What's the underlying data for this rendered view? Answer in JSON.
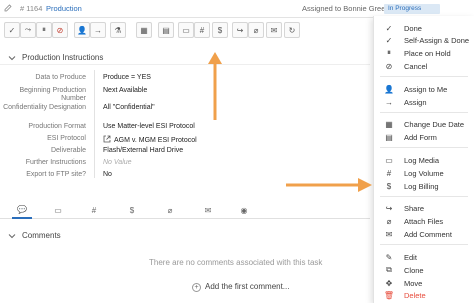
{
  "header": {
    "task_number": "# 1164",
    "task_title": "Production",
    "assigned_text": "Assigned to Bonnie Green by CS",
    "status_badge": "In Progress"
  },
  "toolbar": {
    "buttons": [
      "check-icon",
      "reassign-icon",
      "pause-icon",
      "cancel-icon",
      "assign-icon",
      "advance-icon",
      "flask-icon",
      "due-date-icon",
      "form-icon",
      "media-icon",
      "volume-icon",
      "billing-icon",
      "share-icon",
      "attach-icon",
      "comment-icon",
      "repeat-icon"
    ]
  },
  "section": {
    "title": "Production Instructions"
  },
  "fields": [
    {
      "label": "Data to Produce",
      "value": "Produce = YES"
    },
    {
      "label": "Beginning Production Number",
      "value": "Next Available"
    },
    {
      "label": "Confidentiality Designation",
      "value": "All \"Confidential\""
    },
    {
      "label": "Production Format",
      "value": "Use Matter-level ESI Protocol"
    },
    {
      "label": "ESI Protocol",
      "value": "AGM v. MGM ESI Protocol"
    },
    {
      "label": "Deliverable",
      "value": "Flash/External Hard Drive"
    },
    {
      "label": "Further Instructions",
      "value": "No Value"
    },
    {
      "label": "Export to FTP site?",
      "value": "No"
    }
  ],
  "comments": {
    "title": "Comments",
    "empty_text": "There are no comments associated with this task",
    "add_label": "Add the first comment..."
  },
  "menu": {
    "items": [
      {
        "label": "Done",
        "icon": "check-icon"
      },
      {
        "label": "Self-Assign & Done",
        "icon": "self-assign-done-icon"
      },
      {
        "label": "Place on Hold",
        "icon": "pause-icon"
      },
      {
        "label": "Cancel",
        "icon": "cancel-icon"
      },
      {
        "label": "Assign to Me",
        "icon": "assign-to-me-icon"
      },
      {
        "label": "Assign",
        "icon": "assign-icon"
      },
      {
        "label": "Change Due Date",
        "icon": "calendar-icon"
      },
      {
        "label": "Add Form",
        "icon": "form-icon"
      },
      {
        "label": "Log Media",
        "icon": "media-icon"
      },
      {
        "label": "Log Volume",
        "icon": "volume-icon"
      },
      {
        "label": "Log Billing",
        "icon": "billing-icon"
      },
      {
        "label": "Share",
        "icon": "share-icon"
      },
      {
        "label": "Attach Files",
        "icon": "attach-icon"
      },
      {
        "label": "Add Comment",
        "icon": "comment-icon"
      },
      {
        "label": "Edit",
        "icon": "edit-icon"
      },
      {
        "label": "Clone",
        "icon": "clone-icon"
      },
      {
        "label": "Move",
        "icon": "move-icon"
      },
      {
        "label": "Delete",
        "icon": "delete-icon"
      }
    ]
  },
  "colors": {
    "accent": "#2a6ebb",
    "arrow": "#f0a04b",
    "danger": "#e74c3c"
  }
}
